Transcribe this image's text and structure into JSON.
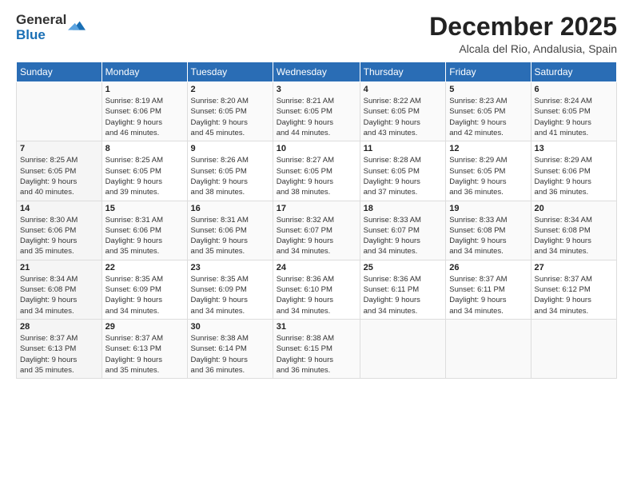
{
  "logo": {
    "general": "General",
    "blue": "Blue"
  },
  "title": "December 2025",
  "subtitle": "Alcala del Rio, Andalusia, Spain",
  "days_header": [
    "Sunday",
    "Monday",
    "Tuesday",
    "Wednesday",
    "Thursday",
    "Friday",
    "Saturday"
  ],
  "weeks": [
    [
      {
        "num": "",
        "info": ""
      },
      {
        "num": "1",
        "info": "Sunrise: 8:19 AM\nSunset: 6:06 PM\nDaylight: 9 hours\nand 46 minutes."
      },
      {
        "num": "2",
        "info": "Sunrise: 8:20 AM\nSunset: 6:05 PM\nDaylight: 9 hours\nand 45 minutes."
      },
      {
        "num": "3",
        "info": "Sunrise: 8:21 AM\nSunset: 6:05 PM\nDaylight: 9 hours\nand 44 minutes."
      },
      {
        "num": "4",
        "info": "Sunrise: 8:22 AM\nSunset: 6:05 PM\nDaylight: 9 hours\nand 43 minutes."
      },
      {
        "num": "5",
        "info": "Sunrise: 8:23 AM\nSunset: 6:05 PM\nDaylight: 9 hours\nand 42 minutes."
      },
      {
        "num": "6",
        "info": "Sunrise: 8:24 AM\nSunset: 6:05 PM\nDaylight: 9 hours\nand 41 minutes."
      }
    ],
    [
      {
        "num": "7",
        "info": "Sunrise: 8:25 AM\nSunset: 6:05 PM\nDaylight: 9 hours\nand 40 minutes."
      },
      {
        "num": "8",
        "info": "Sunrise: 8:25 AM\nSunset: 6:05 PM\nDaylight: 9 hours\nand 39 minutes."
      },
      {
        "num": "9",
        "info": "Sunrise: 8:26 AM\nSunset: 6:05 PM\nDaylight: 9 hours\nand 38 minutes."
      },
      {
        "num": "10",
        "info": "Sunrise: 8:27 AM\nSunset: 6:05 PM\nDaylight: 9 hours\nand 38 minutes."
      },
      {
        "num": "11",
        "info": "Sunrise: 8:28 AM\nSunset: 6:05 PM\nDaylight: 9 hours\nand 37 minutes."
      },
      {
        "num": "12",
        "info": "Sunrise: 8:29 AM\nSunset: 6:05 PM\nDaylight: 9 hours\nand 36 minutes."
      },
      {
        "num": "13",
        "info": "Sunrise: 8:29 AM\nSunset: 6:06 PM\nDaylight: 9 hours\nand 36 minutes."
      }
    ],
    [
      {
        "num": "14",
        "info": "Sunrise: 8:30 AM\nSunset: 6:06 PM\nDaylight: 9 hours\nand 35 minutes."
      },
      {
        "num": "15",
        "info": "Sunrise: 8:31 AM\nSunset: 6:06 PM\nDaylight: 9 hours\nand 35 minutes."
      },
      {
        "num": "16",
        "info": "Sunrise: 8:31 AM\nSunset: 6:06 PM\nDaylight: 9 hours\nand 35 minutes."
      },
      {
        "num": "17",
        "info": "Sunrise: 8:32 AM\nSunset: 6:07 PM\nDaylight: 9 hours\nand 34 minutes."
      },
      {
        "num": "18",
        "info": "Sunrise: 8:33 AM\nSunset: 6:07 PM\nDaylight: 9 hours\nand 34 minutes."
      },
      {
        "num": "19",
        "info": "Sunrise: 8:33 AM\nSunset: 6:08 PM\nDaylight: 9 hours\nand 34 minutes."
      },
      {
        "num": "20",
        "info": "Sunrise: 8:34 AM\nSunset: 6:08 PM\nDaylight: 9 hours\nand 34 minutes."
      }
    ],
    [
      {
        "num": "21",
        "info": "Sunrise: 8:34 AM\nSunset: 6:08 PM\nDaylight: 9 hours\nand 34 minutes."
      },
      {
        "num": "22",
        "info": "Sunrise: 8:35 AM\nSunset: 6:09 PM\nDaylight: 9 hours\nand 34 minutes."
      },
      {
        "num": "23",
        "info": "Sunrise: 8:35 AM\nSunset: 6:09 PM\nDaylight: 9 hours\nand 34 minutes."
      },
      {
        "num": "24",
        "info": "Sunrise: 8:36 AM\nSunset: 6:10 PM\nDaylight: 9 hours\nand 34 minutes."
      },
      {
        "num": "25",
        "info": "Sunrise: 8:36 AM\nSunset: 6:11 PM\nDaylight: 9 hours\nand 34 minutes."
      },
      {
        "num": "26",
        "info": "Sunrise: 8:37 AM\nSunset: 6:11 PM\nDaylight: 9 hours\nand 34 minutes."
      },
      {
        "num": "27",
        "info": "Sunrise: 8:37 AM\nSunset: 6:12 PM\nDaylight: 9 hours\nand 34 minutes."
      }
    ],
    [
      {
        "num": "28",
        "info": "Sunrise: 8:37 AM\nSunset: 6:13 PM\nDaylight: 9 hours\nand 35 minutes."
      },
      {
        "num": "29",
        "info": "Sunrise: 8:37 AM\nSunset: 6:13 PM\nDaylight: 9 hours\nand 35 minutes."
      },
      {
        "num": "30",
        "info": "Sunrise: 8:38 AM\nSunset: 6:14 PM\nDaylight: 9 hours\nand 36 minutes."
      },
      {
        "num": "31",
        "info": "Sunrise: 8:38 AM\nSunset: 6:15 PM\nDaylight: 9 hours\nand 36 minutes."
      },
      {
        "num": "",
        "info": ""
      },
      {
        "num": "",
        "info": ""
      },
      {
        "num": "",
        "info": ""
      }
    ]
  ]
}
